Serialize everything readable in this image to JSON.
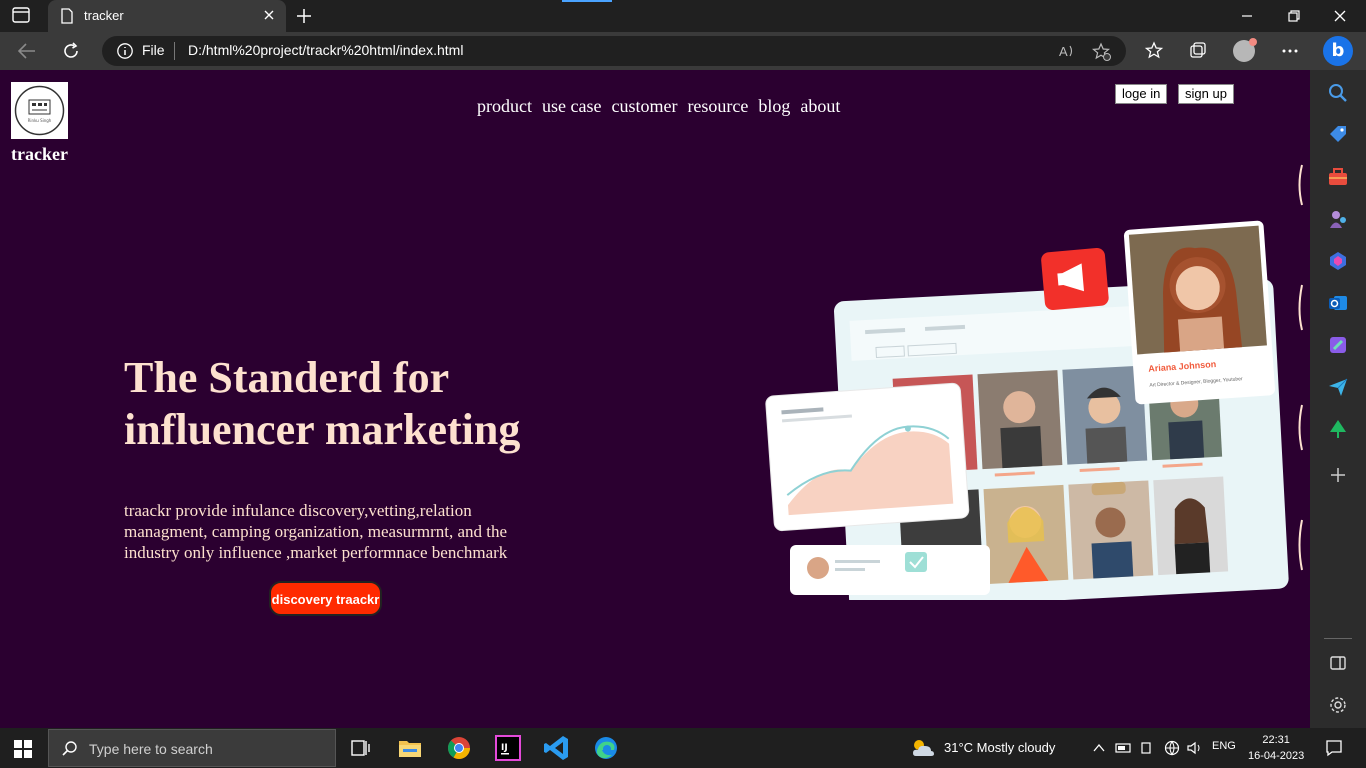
{
  "browser": {
    "tab_title": "tracker",
    "scheme_label": "File",
    "url": "D:/html%20project/trackr%20html/index.html"
  },
  "page": {
    "brand": "tracker",
    "logo_alt": "Rinku Singh",
    "nav": [
      "product",
      "use case",
      "customer",
      "resource",
      "blog",
      "about"
    ],
    "login_label": "loge in",
    "signup_label": "sign up",
    "hero_title": "The Standerd for influencer marketing",
    "hero_desc": "traackr provide infulance discovery,vetting,relation managment, camping organization, measurmrnt, and the industry only influence ,market performnace benchmark",
    "cta_label": "discovery traackr",
    "profile_name": "Ariana Johnson",
    "profile_sub": "Art Director & Designer, Blogger, Youtuber",
    "colors": {
      "page_bg": "#2b0030",
      "hero_text": "#fde1cf",
      "cta": "#ff2a00",
      "card_accent": "#f15a3b"
    }
  },
  "taskbar": {
    "search_placeholder": "Type here to search",
    "weather": "31°C  Mostly cloudy",
    "lang": "ENG",
    "time": "22:31",
    "date": "16-04-2023"
  }
}
